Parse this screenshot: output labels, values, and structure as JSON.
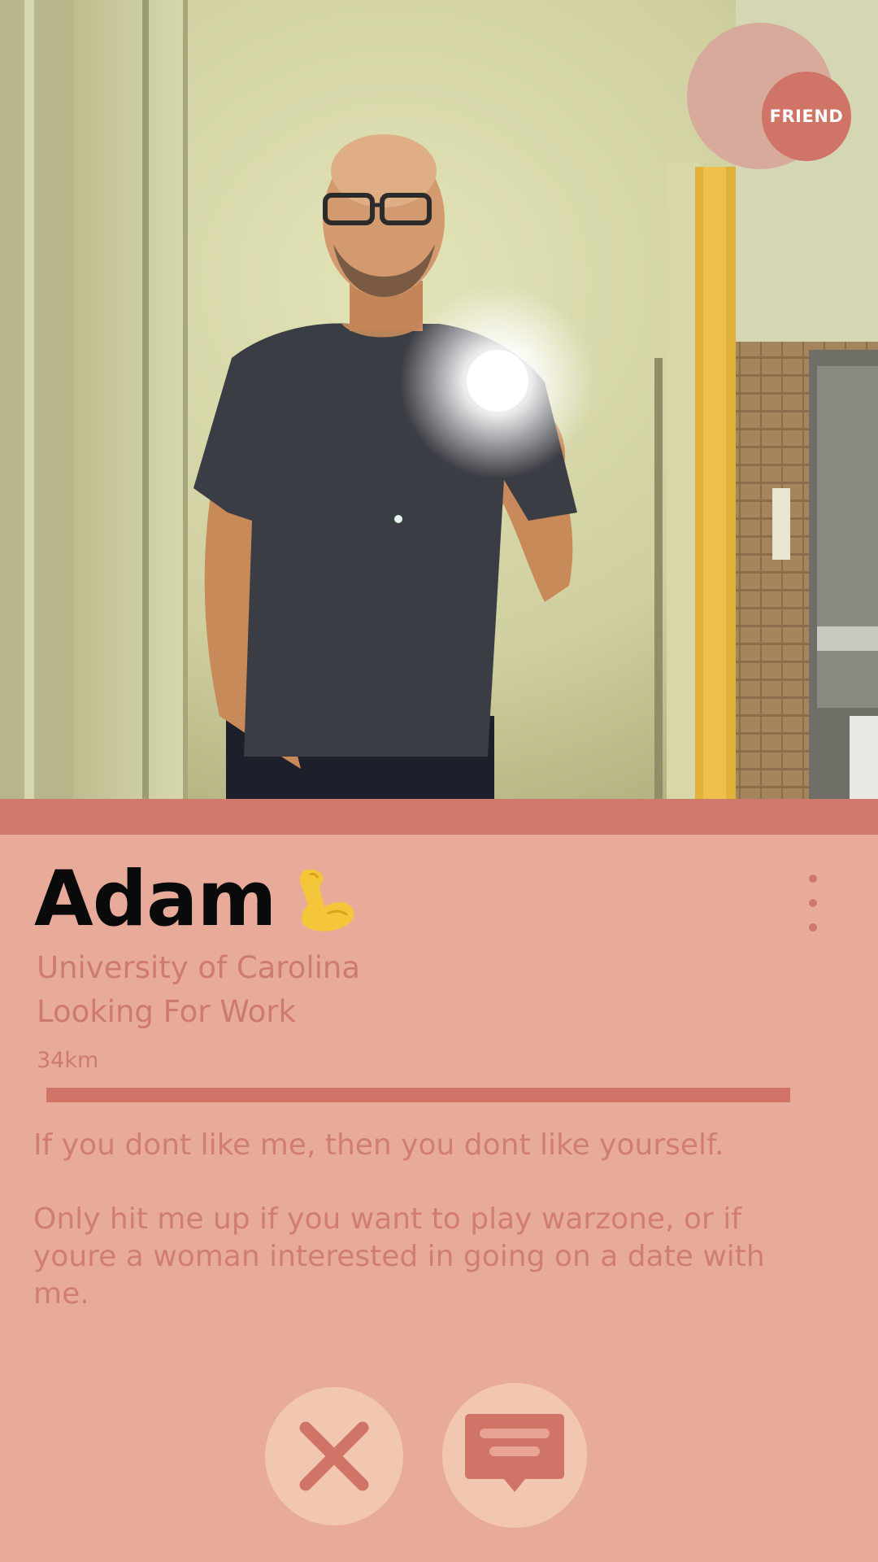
{
  "profile": {
    "name": "Adam",
    "name_emoji": "flexed-biceps-icon",
    "school": "University of Carolina",
    "job": "Looking For Work",
    "distance": "34km",
    "photo_progress": 1.0,
    "bio": [
      "If you dont like me, then you dont like yourself.",
      "Only hit me up if you want to play warzone, or if youre a woman interested in going on a date with me."
    ]
  },
  "badge": {
    "label": "FRIEND"
  },
  "actions": {
    "dislike_icon": "close-icon",
    "message_icon": "chat-bubble-icon"
  },
  "colors": {
    "card_background": "#e8ab9a",
    "accent": "#d07468",
    "button_background": "#f2c7b1",
    "name_text": "#0a0a0a",
    "secondary_text": "#cd7b70"
  }
}
